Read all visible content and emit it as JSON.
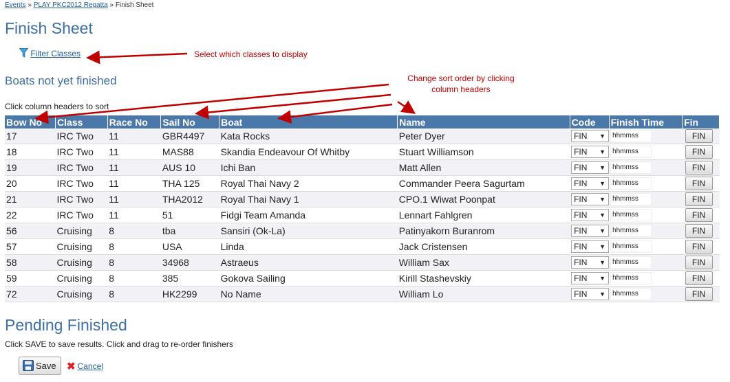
{
  "breadcrumb": {
    "events": "Events",
    "sep1": "»",
    "regatta": "PLAY PKC2012 Regatta",
    "sep2": "»",
    "current": "Finish Sheet"
  },
  "page_title": "Finish Sheet",
  "filter_label": "Filter Classes",
  "annotations": {
    "filter": "Select which classes to display",
    "sort_line1": "Change sort order by clicking",
    "sort_line2": "column headers"
  },
  "boats_section": {
    "title": "Boats not yet finished",
    "hint": "Click column headers to sort",
    "columns": [
      "Bow No",
      "Class",
      "Race No",
      "Sail No",
      "Boat",
      "Name",
      "Code",
      "Finish Time",
      "Fin"
    ],
    "code_value": "FIN",
    "time_placeholder": "hhmmss",
    "fin_label": "FIN",
    "rows": [
      [
        "17",
        "IRC Two",
        "11",
        "GBR4497",
        "Kata Rocks",
        "Peter Dyer"
      ],
      [
        "18",
        "IRC Two",
        "11",
        "MAS88",
        "Skandia Endeavour Of Whitby",
        "Stuart Williamson"
      ],
      [
        "19",
        "IRC Two",
        "11",
        "AUS 10",
        "Ichi Ban",
        "Matt Allen"
      ],
      [
        "20",
        "IRC Two",
        "11",
        "THA 125",
        "Royal Thai Navy 2",
        "Commander Peera Sagurtam"
      ],
      [
        "21",
        "IRC Two",
        "11",
        "THA2012",
        "Royal Thai Navy 1",
        "CPO.1 Wiwat Poonpat"
      ],
      [
        "22",
        "IRC Two",
        "11",
        "51",
        "Fidgi Team Amanda",
        "Lennart Fahlgren"
      ],
      [
        "56",
        "Cruising",
        "8",
        "tba",
        "Sansiri (Ok-La)",
        "Patinyakorn Buranrom"
      ],
      [
        "57",
        "Cruising",
        "8",
        "USA",
        "Linda",
        "Jack Cristensen"
      ],
      [
        "58",
        "Cruising",
        "8",
        "34968",
        "Astraeus",
        "William Sax"
      ],
      [
        "59",
        "Cruising",
        "8",
        "385",
        "Gokova Sailing",
        "Kirill Stashevskiy"
      ],
      [
        "72",
        "Cruising",
        "8",
        "HK2299",
        "No Name",
        "William Lo"
      ]
    ]
  },
  "pending_section": {
    "title": "Pending Finished",
    "hint": "Click SAVE to save results. Click and drag to re-order finishers",
    "save_label": "Save",
    "cancel_label": "Cancel"
  },
  "icons": {
    "filter": "funnel-icon",
    "save": "floppy-disk-icon",
    "cancel": "red-x-icon",
    "dropdown": "dropdown-caret-icon"
  },
  "colors": {
    "header_bg": "#4a78a8",
    "title": "#3d6fa3",
    "annotation": "#c00000",
    "link": "#1f5d9c"
  }
}
